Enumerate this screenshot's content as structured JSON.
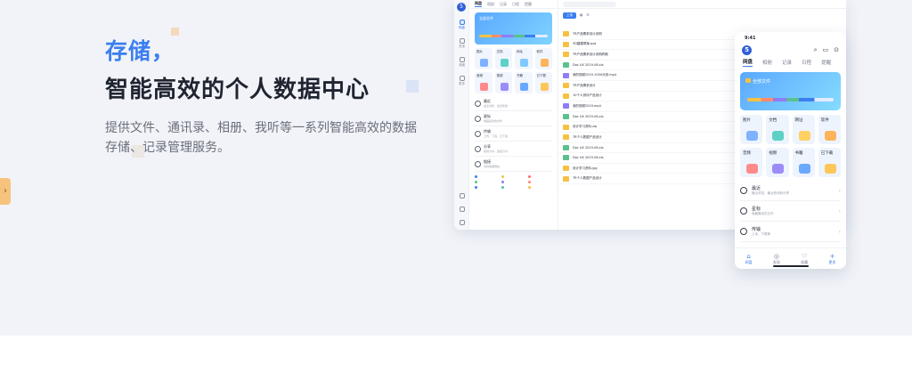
{
  "hero": {
    "accent": "存储，",
    "title": "智能高效的个人数据中心",
    "desc": "提供文件、通讯录、相册、我听等一系列智能高效的数据存储、记录管理服务。"
  },
  "colors": {
    "accent": "#3b7ef0",
    "background": "#f1f3f8"
  },
  "desktop": {
    "tabs": [
      "网盘",
      "相册",
      "记录",
      "日程",
      "提醒"
    ],
    "all_files": "全部文件",
    "categories": [
      "图片",
      "文档",
      "网址",
      "软件",
      "音频",
      "视频",
      "书籍",
      "已下载"
    ],
    "rows": [
      {
        "title": "最近",
        "sub": "最近浏览、最近修改"
      },
      {
        "title": "星标",
        "sub": "收藏喜欢的文件"
      },
      {
        "title": "传输",
        "sub": "上传、下载、云下载"
      },
      {
        "title": "分享",
        "sub": "我的分享、链接分享"
      },
      {
        "title": "链接",
        "sub": "支持收藏网站"
      }
    ],
    "upload": "上传",
    "files": [
      "TR产品需求设计说明",
      "3D建模草案.psd",
      "TR产品需求设计说明终稿",
      "Doc UX 2019-06.xls",
      "我的视频2019-1000分钟.mp4",
      "TR产品需求设计",
      "10个人测评产品设计",
      "我的视频2019.mp4",
      "Doc UX 2019-06.xls",
      "设计学习资料.zip",
      "TR个人数据产品设计",
      "Doc UX 2019-06.xls",
      "Doc UX 2019-06.xls",
      "设计学习资料.jpg",
      "TR个人数据产品设计"
    ]
  },
  "phone": {
    "time": "9:41",
    "logo": "5",
    "tabs": [
      "网盘",
      "相册",
      "记录",
      "日程",
      "提醒"
    ],
    "all_files": "全部文件",
    "categories": [
      "图片",
      "文档",
      "网址",
      "软件",
      "音频",
      "视频",
      "书籍",
      "已下载"
    ],
    "rows": [
      {
        "title": "最近",
        "sub": "最近浏览、最近修改和分享"
      },
      {
        "title": "星标",
        "sub": "收藏喜欢的文件"
      },
      {
        "title": "传输",
        "sub": "上传、下载等"
      }
    ],
    "nav": [
      "网盘",
      "发现",
      "收藏",
      "更多"
    ]
  }
}
